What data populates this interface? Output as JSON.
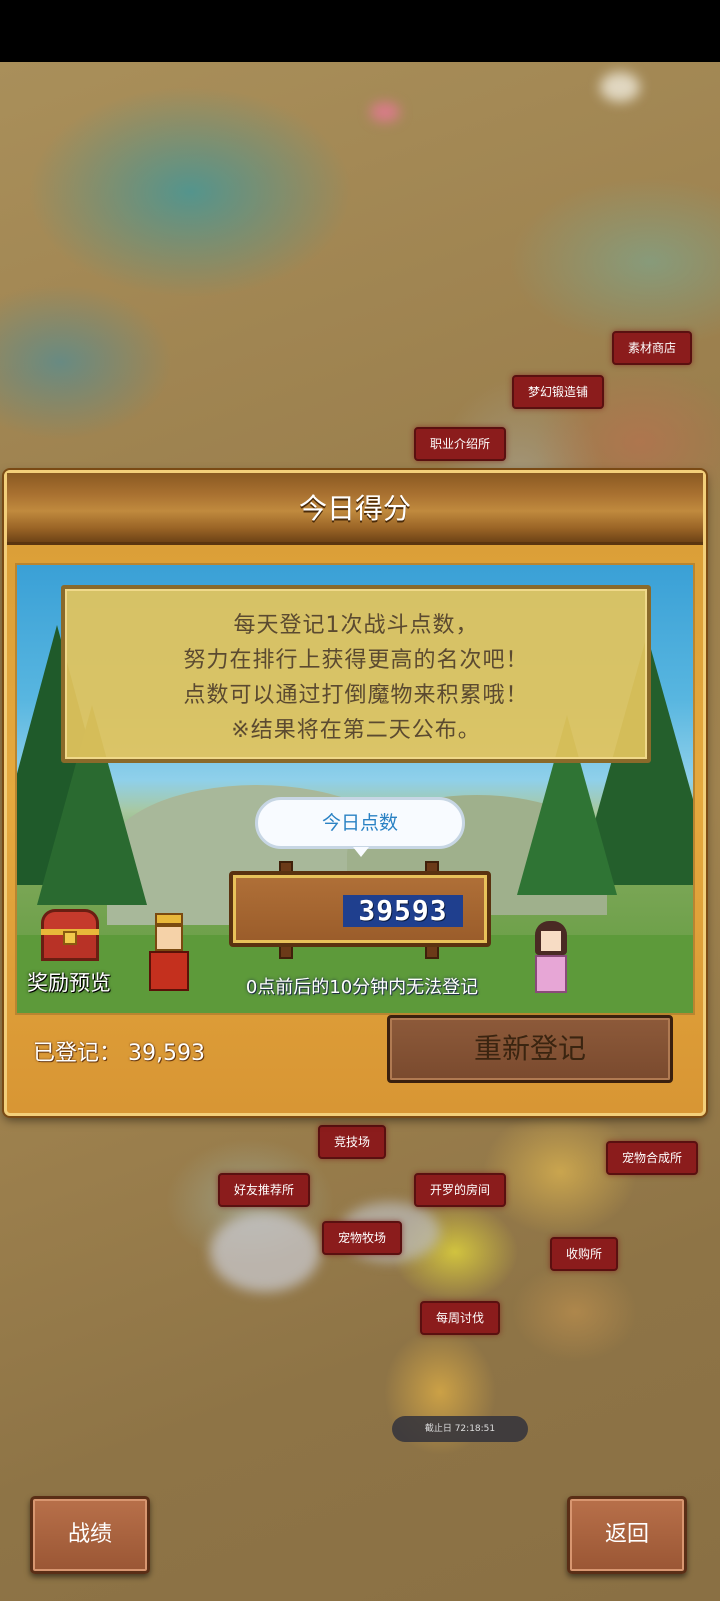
{
  "map_labels": {
    "material_shop": "素材商店",
    "forge": "梦幻锻造铺",
    "job_agency": "职业介绍所",
    "arena": "竞技场",
    "pet_fusion": "宠物合成所",
    "friend_recommend": "好友推荐所",
    "kairo_room": "开罗的房间",
    "pet_ranch": "宠物牧场",
    "buyer": "收购所",
    "weekly_hunt": "每周讨伐",
    "deadline": "截止日 72:18:51"
  },
  "panel": {
    "title": "今日得分",
    "info_lines": [
      "每天登记1次战斗点数，",
      "努力在排行上获得更高的名次吧！",
      "点数可以通过打倒魔物来积累哦！",
      "※结果将在第二天公布。"
    ],
    "bubble_label": "今日点数",
    "today_score": "39593",
    "warning": "0点前后的10分钟内无法登记",
    "reward_preview": "奖励预览",
    "registered_label": "已登记：",
    "registered_value": "39,593",
    "re_register_button": "重新登记"
  },
  "bottom": {
    "record_button": "战绩",
    "back_button": "返回"
  }
}
